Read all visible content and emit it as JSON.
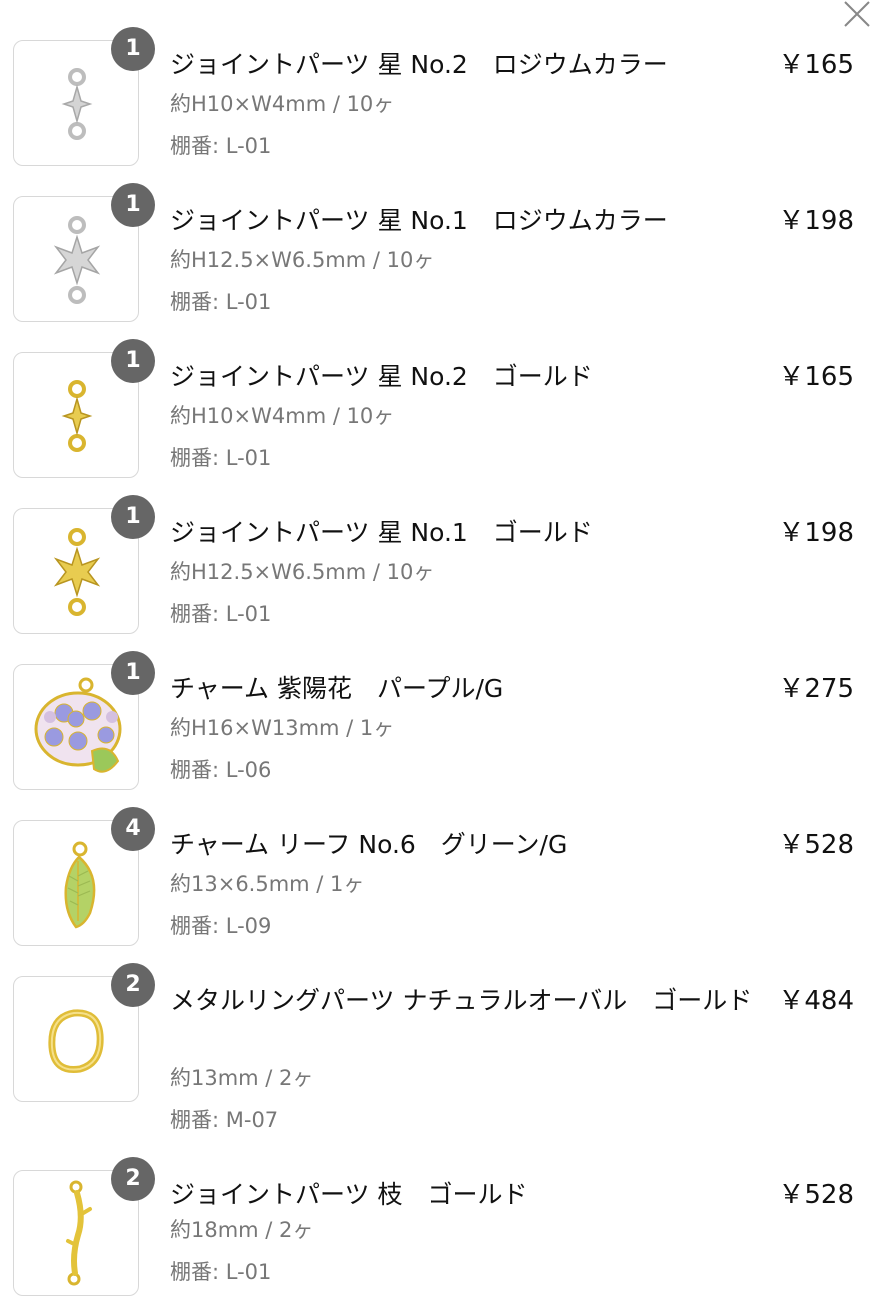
{
  "close_label": "close",
  "items": [
    {
      "qty": "1",
      "name": "ジョイントパーツ 星 No.2　ロジウムカラー",
      "price": "￥165",
      "spec": "約H10×W4mm / 10ヶ",
      "shelf": "棚番: L-01",
      "image": "star-connector-small-silver-icon",
      "metal": "#c9c9c9"
    },
    {
      "qty": "1",
      "name": "ジョイントパーツ 星 No.1　ロジウムカラー",
      "price": "￥198",
      "spec": "約H12.5×W6.5mm / 10ヶ",
      "shelf": "棚番: L-01",
      "image": "star-connector-large-silver-icon",
      "metal": "#c9c9c9"
    },
    {
      "qty": "1",
      "name": "ジョイントパーツ 星 No.2　ゴールド",
      "price": "￥165",
      "spec": "約H10×W4mm / 10ヶ",
      "shelf": "棚番: L-01",
      "image": "star-connector-small-gold-icon",
      "metal": "#e3c33a"
    },
    {
      "qty": "1",
      "name": "ジョイントパーツ 星 No.1　ゴールド",
      "price": "￥198",
      "spec": "約H12.5×W6.5mm / 10ヶ",
      "shelf": "棚番: L-01",
      "image": "star-connector-large-gold-icon",
      "metal": "#e3c33a"
    },
    {
      "qty": "1",
      "name": "チャーム 紫陽花　パープル/G",
      "price": "￥275",
      "spec": "約H16×W13mm / 1ヶ",
      "shelf": "棚番: L-06",
      "image": "hydrangea-charm-icon",
      "metal": "#e3c33a"
    },
    {
      "qty": "4",
      "name": "チャーム リーフ No.6　グリーン/G",
      "price": "￥528",
      "spec": "約13×6.5mm / 1ヶ",
      "shelf": "棚番: L-09",
      "image": "leaf-charm-icon",
      "metal": "#e3c33a"
    },
    {
      "qty": "2",
      "name": "メタルリングパーツ ナチュラルオーバル　ゴールド",
      "price": "￥484",
      "spec": "約13mm / 2ヶ",
      "shelf": "棚番: M-07",
      "image": "oval-ring-icon",
      "metal": "#e3c33a"
    },
    {
      "qty": "2",
      "name": "ジョイントパーツ 枝　ゴールド",
      "price": "￥528",
      "spec": "約18mm / 2ヶ",
      "shelf": "棚番: L-01",
      "image": "branch-connector-icon",
      "metal": "#e3c33a"
    }
  ]
}
